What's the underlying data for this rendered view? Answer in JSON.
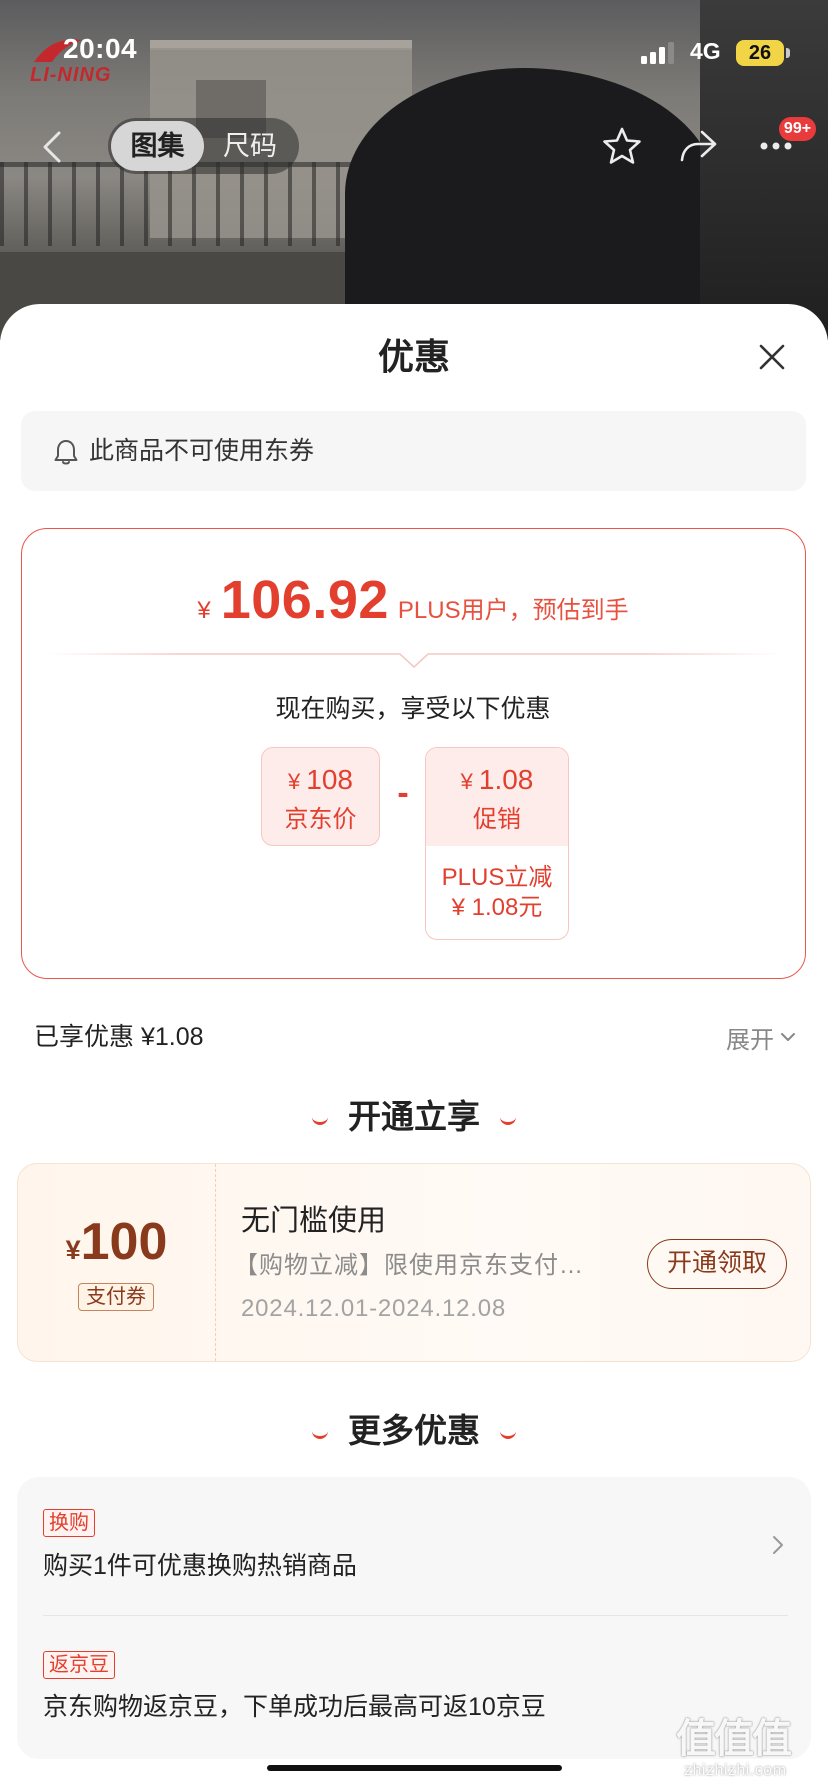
{
  "status_bar": {
    "time": "20:04",
    "network": "4G",
    "battery": "26"
  },
  "brand_logo": {
    "text": "LI-NING"
  },
  "top_nav": {
    "back_icon": "chevron-left-icon",
    "tabs": [
      {
        "label": "图集",
        "active": true
      },
      {
        "label": "尺码",
        "active": false
      }
    ],
    "action_icons": [
      "star-icon",
      "share-icon",
      "more-icon"
    ],
    "more_badge": "99+"
  },
  "sheet": {
    "title": "优惠",
    "close_icon": "close-icon"
  },
  "notice": {
    "icon": "bell-icon",
    "text": "此商品不可使用东券"
  },
  "price_card": {
    "currency": "¥",
    "price": "106.92",
    "price_note": "PLUS用户，预估到手",
    "subtitle": "现在购买，享受以下优惠",
    "base_price": {
      "currency": "¥",
      "amount": "108",
      "label": "京东价"
    },
    "operator": "-",
    "discount": {
      "currency": "¥",
      "amount": "1.08",
      "label": "促销",
      "detail_title": "PLUS立减",
      "detail_amount": "¥ 1.08元"
    }
  },
  "summary": {
    "text": "已享优惠 ¥1.08",
    "expand_label": "展开"
  },
  "open_section": {
    "title": "开通立享"
  },
  "coupon": {
    "currency": "¥",
    "amount": "100",
    "type": "支付券",
    "title": "无门槛使用",
    "desc": "【购物立减】限使用京东支付…",
    "validity": "2024.12.01-2024.12.08",
    "button": "开通领取"
  },
  "more_section": {
    "title": "更多优惠"
  },
  "more_offers": [
    {
      "tag": "换购",
      "text": "购买1件可优惠换购热销商品",
      "arrow": "chevron-right-icon"
    },
    {
      "tag": "返京豆",
      "text": "京东购物返京豆，下单成功后最高可返10京豆"
    }
  ],
  "watermark": {
    "mark": "值值值",
    "site": "zhizhizhi.com"
  },
  "colors": {
    "accent": "#e23f2e",
    "coupon_brown": "#8a3a1c",
    "price_box_pink": "#fdecea",
    "battery_yellow": "#f2d546",
    "badge_red": "#e93b3b"
  }
}
